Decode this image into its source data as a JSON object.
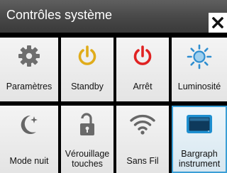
{
  "window": {
    "title": "Contrôles système",
    "close_icon": "close-icon"
  },
  "colors": {
    "titlebar": "#4a4a4a",
    "tile": "#ececec",
    "gear": "#6e6e6e",
    "standby": "#e0ac1a",
    "power": "#e02222",
    "brightness": "#2f8ed0",
    "moon": "#666666",
    "lock": "#6a6a6a",
    "wifi": "#666666",
    "instrument": "#1e8fd0"
  },
  "tiles": [
    {
      "label": "Paramètres",
      "icon": "gear-icon"
    },
    {
      "label": "Standby",
      "icon": "standby-icon"
    },
    {
      "label": "Arrêt",
      "icon": "power-icon"
    },
    {
      "label": "Luminosité",
      "icon": "brightness-icon"
    },
    {
      "label": "Mode nuit",
      "icon": "moon-star-icon"
    },
    {
      "label": "Vérouillage\ntouches",
      "icon": "unlock-icon"
    },
    {
      "label": "Sans Fil",
      "icon": "wifi-icon"
    },
    {
      "label": "Bargraph\ninstrument",
      "icon": "instrument-screen-icon",
      "selected": true
    }
  ]
}
